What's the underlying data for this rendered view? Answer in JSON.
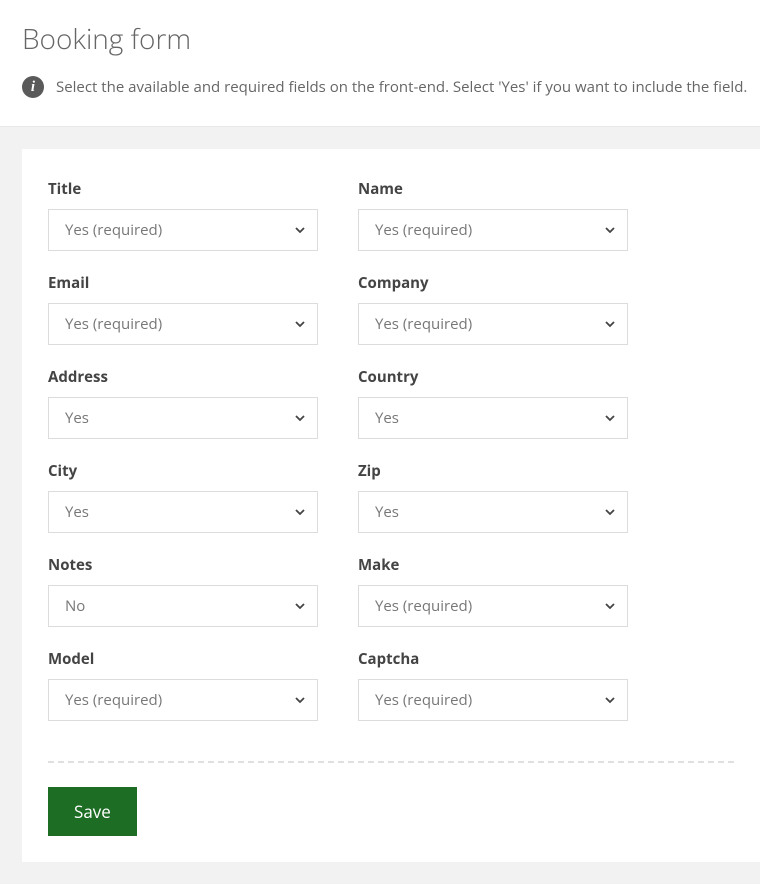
{
  "header": {
    "title": "Booking form",
    "info_text": "Select the available and required fields on the front-end. Select 'Yes' if you want to include the field."
  },
  "select_options": [
    "Yes (required)",
    "Yes",
    "No"
  ],
  "fields": [
    {
      "key": "title",
      "label": "Title",
      "value": "Yes (required)"
    },
    {
      "key": "name",
      "label": "Name",
      "value": "Yes (required)"
    },
    {
      "key": "email",
      "label": "Email",
      "value": "Yes (required)"
    },
    {
      "key": "company",
      "label": "Company",
      "value": "Yes (required)"
    },
    {
      "key": "address",
      "label": "Address",
      "value": "Yes"
    },
    {
      "key": "country",
      "label": "Country",
      "value": "Yes"
    },
    {
      "key": "city",
      "label": "City",
      "value": "Yes"
    },
    {
      "key": "zip",
      "label": "Zip",
      "value": "Yes"
    },
    {
      "key": "notes",
      "label": "Notes",
      "value": "No"
    },
    {
      "key": "make",
      "label": "Make",
      "value": "Yes (required)"
    },
    {
      "key": "model",
      "label": "Model",
      "value": "Yes (required)"
    },
    {
      "key": "captcha",
      "label": "Captcha",
      "value": "Yes (required)"
    }
  ],
  "actions": {
    "save_label": "Save"
  }
}
